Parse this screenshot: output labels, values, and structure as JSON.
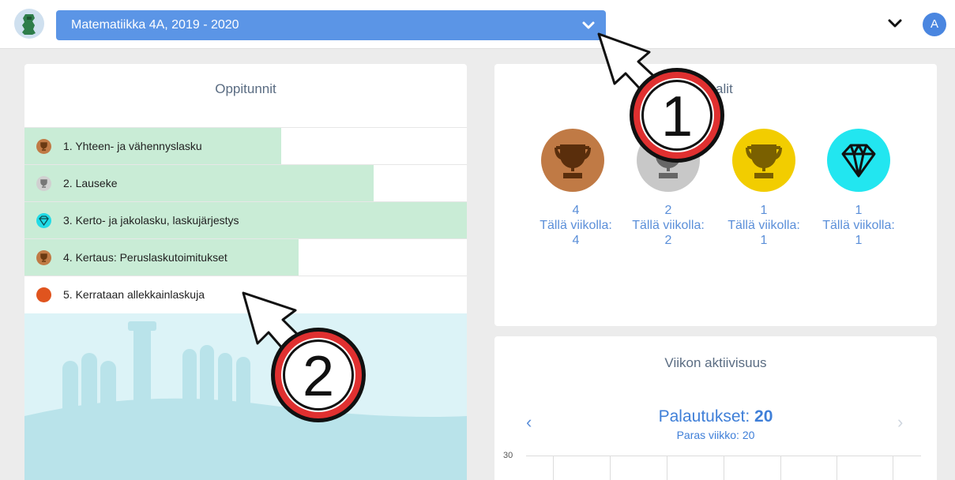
{
  "header": {
    "course": "Matematiikka 4A, 2019 - 2020",
    "avatar_initial": "A"
  },
  "lessons_panel": {
    "title": "Oppitunnit",
    "lessons": [
      {
        "label": "1. Yhteen- ja vähennyslasku",
        "icon": "bronze-trophy-icon",
        "progress": 0.58
      },
      {
        "label": "2. Lauseke",
        "icon": "silver-trophy-icon",
        "progress": 0.79
      },
      {
        "label": "3. Kerto- ja jakolasku, laskujärjestys",
        "icon": "diamond-icon",
        "progress": 1.0
      },
      {
        "label": "4. Kertaus: Peruslaskutoimitukset",
        "icon": "bronze-trophy-icon",
        "progress": 0.62
      },
      {
        "label": "5. Kerrataan allekkainlaskuja",
        "icon": "orange-dot-icon",
        "progress": 0
      }
    ]
  },
  "medals_panel": {
    "title_visible": "alit",
    "medals": [
      {
        "name": "bronze",
        "count": "4",
        "week_label": "Tällä viikolla:",
        "week_count": "4",
        "color": "#c07a45"
      },
      {
        "name": "silver",
        "count": "2",
        "week_label": "Tällä viikolla:",
        "week_count": "2",
        "color": "#c8c8c8"
      },
      {
        "name": "gold",
        "count": "1",
        "week_label": "Tällä viikolla:",
        "week_count": "1",
        "color": "#f2cd00"
      },
      {
        "name": "diamond",
        "count": "1",
        "week_label": "Tällä viikolla:",
        "week_count": "1",
        "color": "#22e6f0"
      }
    ]
  },
  "activity_panel": {
    "title": "Viikon aktiivisuus",
    "submissions_label": "Palautukset:",
    "submissions_value": "20",
    "best_week": "Paras viikko: 20",
    "y_tick": "30",
    "prev": "‹",
    "next": "›"
  },
  "callouts": [
    "1",
    "2"
  ]
}
